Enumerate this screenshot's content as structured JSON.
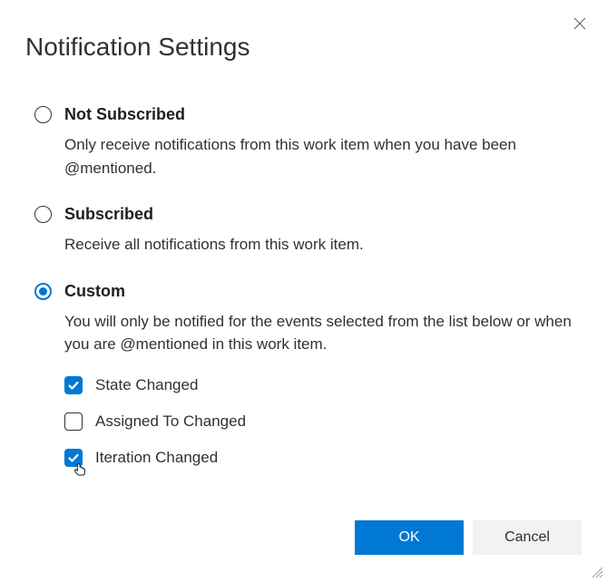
{
  "title": "Notification Settings",
  "options": {
    "not_subscribed": {
      "label": "Not Subscribed",
      "desc": "Only receive notifications from this work item when you have been @mentioned.",
      "selected": false
    },
    "subscribed": {
      "label": "Subscribed",
      "desc": "Receive all notifications from this work item.",
      "selected": false
    },
    "custom": {
      "label": "Custom",
      "desc": "You will only be notified for the events selected from the list below or when you are @mentioned in this work item.",
      "selected": true,
      "checks": {
        "state_changed": {
          "label": "State Changed",
          "checked": true
        },
        "assigned_to_changed": {
          "label": "Assigned To Changed",
          "checked": false
        },
        "iteration_changed": {
          "label": "Iteration Changed",
          "checked": true
        }
      }
    }
  },
  "buttons": {
    "ok": "OK",
    "cancel": "Cancel"
  }
}
